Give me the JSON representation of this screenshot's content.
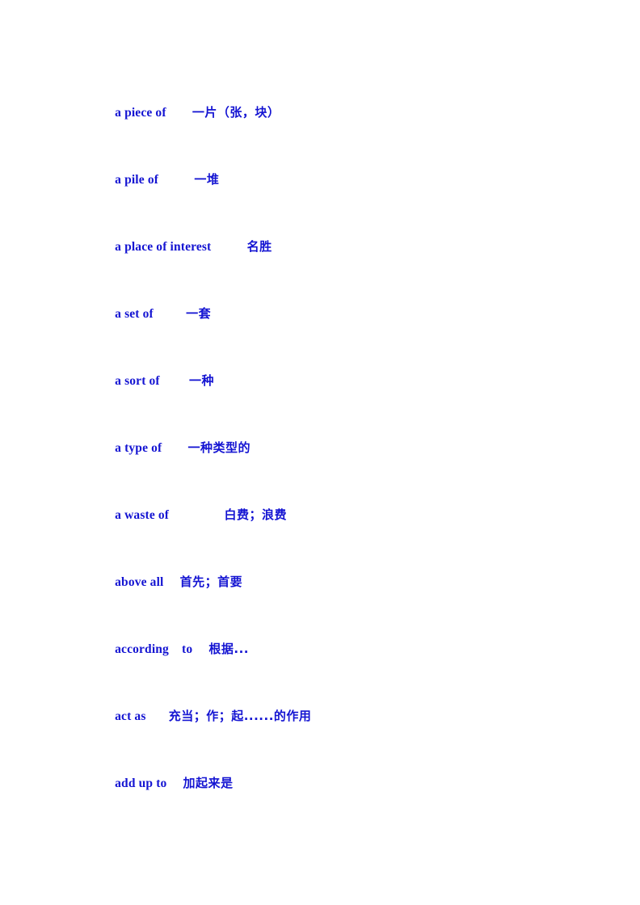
{
  "document": {
    "page_background": "#ffffff",
    "text_color": "#1414d2",
    "entries": [
      {
        "english": "a piece of",
        "gap": "        ",
        "chinese": "一片（张，块）"
      },
      {
        "english": "a pile of",
        "gap": "           ",
        "chinese": "一堆"
      },
      {
        "english": "a place of interest",
        "gap": "           ",
        "chinese": "名胜"
      },
      {
        "english": "a set of",
        "gap": "          ",
        "chinese": "一套"
      },
      {
        "english": "a sort of",
        "gap": "         ",
        "chinese": "一种"
      },
      {
        "english": "a type of",
        "gap": "        ",
        "chinese": "一种类型的"
      },
      {
        "english": "a waste of",
        "gap": "                 ",
        "chinese": "白费；浪费"
      },
      {
        "english": "above all",
        "gap": "     ",
        "chinese": "首先；首要"
      },
      {
        "english": "according    to",
        "gap": "     ",
        "chinese": "根据..."
      },
      {
        "english": "act as",
        "gap": "       ",
        "chinese": "充当；作；起......的作用"
      },
      {
        "english": "add up to",
        "gap": "     ",
        "chinese": "加起来是"
      }
    ]
  }
}
